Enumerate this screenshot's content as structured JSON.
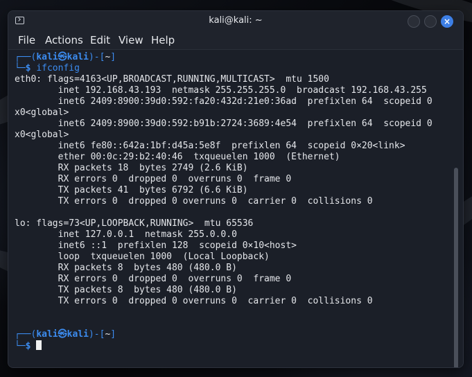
{
  "window": {
    "title": "kali@kali: ~",
    "close_glyph": "×"
  },
  "menu": {
    "items": [
      "File",
      "Actions",
      "Edit",
      "View",
      "Help"
    ]
  },
  "prompt": {
    "top": "┌──(",
    "user": "kali",
    "symbol": "㉿",
    "host": "kali",
    "mid": ")-[",
    "dir": "~",
    "end": "]",
    "bottom": "└─",
    "dollar": "$"
  },
  "command": "ifconfig",
  "output": [
    "eth0: flags=4163<UP,BROADCAST,RUNNING,MULTICAST>  mtu 1500",
    "        inet 192.168.43.193  netmask 255.255.255.0  broadcast 192.168.43.255",
    "        inet6 2409:8900:39d0:592:fa20:432d:21e0:36ad  prefixlen 64  scopeid 0",
    "x0<global>",
    "        inet6 2409:8900:39d0:592:b91b:2724:3689:4e54  prefixlen 64  scopeid 0",
    "x0<global>",
    "        inet6 fe80::642a:1bf:d45a:5e8f  prefixlen 64  scopeid 0×20<link>",
    "        ether 00:0c:29:b2:40:46  txqueuelen 1000  (Ethernet)",
    "        RX packets 18  bytes 2749 (2.6 KiB)",
    "        RX errors 0  dropped 0  overruns 0  frame 0",
    "        TX packets 41  bytes 6792 (6.6 KiB)",
    "        TX errors 0  dropped 0 overruns 0  carrier 0  collisions 0",
    "",
    "lo: flags=73<UP,LOOPBACK,RUNNING>  mtu 65536",
    "        inet 127.0.0.1  netmask 255.0.0.0",
    "        inet6 ::1  prefixlen 128  scopeid 0×10<host>",
    "        loop  txqueuelen 1000  (Local Loopback)",
    "        RX packets 8  bytes 480 (480.0 B)",
    "        RX errors 0  dropped 0  overruns 0  frame 0",
    "        TX packets 8  bytes 480 (480.0 B)",
    "        TX errors 0  dropped 0 overruns 0  carrier 0  collisions 0",
    "",
    ""
  ],
  "colors": {
    "prompt_accent": "#3c8cf0",
    "close_button": "#3d7fe6",
    "terminal_bg": "#1b1f28"
  }
}
